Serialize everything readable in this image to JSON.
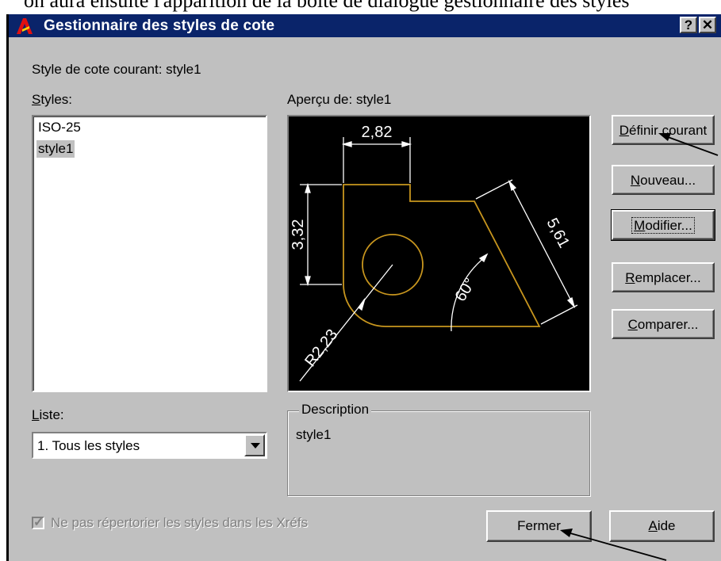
{
  "document_text": "on aura ensuite l'apparition de la boîte de dialogue gestionnaire des styles",
  "window": {
    "title": "Gestionnaire des styles de cote",
    "help_button": "?",
    "close_button": "✕",
    "app_icon": "autocad-logo-icon"
  },
  "current_style_label": "Style de cote courant: style1",
  "styles": {
    "label_prefix": "",
    "label_accel": "S",
    "label_rest": "tyles:",
    "items": [
      "ISO-25",
      "style1"
    ],
    "selected": "style1"
  },
  "preview": {
    "label": "Aperçu de: style1",
    "dimensions": {
      "horizontal": "2,82",
      "vertical": "3,32",
      "aligned": "5,61",
      "angle": "60°",
      "radius": "R2,23"
    },
    "colors": {
      "geometry": "#c8961e",
      "dimension": "#ffffff",
      "background": "#000000"
    }
  },
  "buttons": {
    "set_current": {
      "accel": "D",
      "rest": "éfinir courant"
    },
    "new": {
      "accel": "N",
      "rest": "ouveau..."
    },
    "modify": {
      "accel": "M",
      "rest": "odifier..."
    },
    "replace": {
      "accel": "R",
      "rest": "emplacer..."
    },
    "compare": {
      "accel": "C",
      "rest": "omparer..."
    },
    "close": {
      "label": "Fermer"
    },
    "help": {
      "accel": "A",
      "rest": "ide"
    }
  },
  "list_filter": {
    "label_accel": "L",
    "label_rest": "iste:",
    "value": "1. Tous les styles"
  },
  "description": {
    "title": "Description",
    "text": "style1"
  },
  "xref_checkbox": {
    "label": "Ne pas répertorier les styles dans les Xréfs",
    "checked": true,
    "disabled": true
  }
}
